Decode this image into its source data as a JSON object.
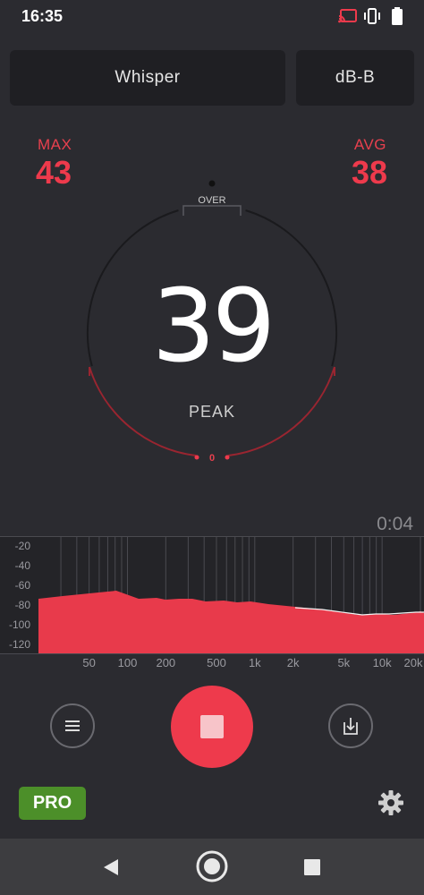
{
  "status": {
    "time": "16:35",
    "icons": [
      "cast-icon",
      "vibrate-icon",
      "battery-icon"
    ]
  },
  "header": {
    "preset_label": "Whisper",
    "weighting_label": "dB-B"
  },
  "stats": {
    "max_label": "MAX",
    "max_value": "43",
    "avg_label": "AVG",
    "avg_value": "38"
  },
  "gauge": {
    "value": "39",
    "label": "PEAK",
    "over_label": "OVER",
    "zero_label": "0",
    "level_fraction": 0.39
  },
  "timer": "0:04",
  "spectrum": {
    "y_ticks": [
      "-20",
      "-40",
      "-60",
      "-80",
      "-100",
      "-120"
    ],
    "x_ticks": [
      "50",
      "100",
      "200",
      "500",
      "1k",
      "2k",
      "5k",
      "10k",
      "20k"
    ]
  },
  "controls": {
    "pro_label": "PRO"
  },
  "colors": {
    "accent": "#ee3a4c",
    "background": "#2b2b30",
    "panel": "#1f1f23",
    "pro": "#4c8f29"
  }
}
